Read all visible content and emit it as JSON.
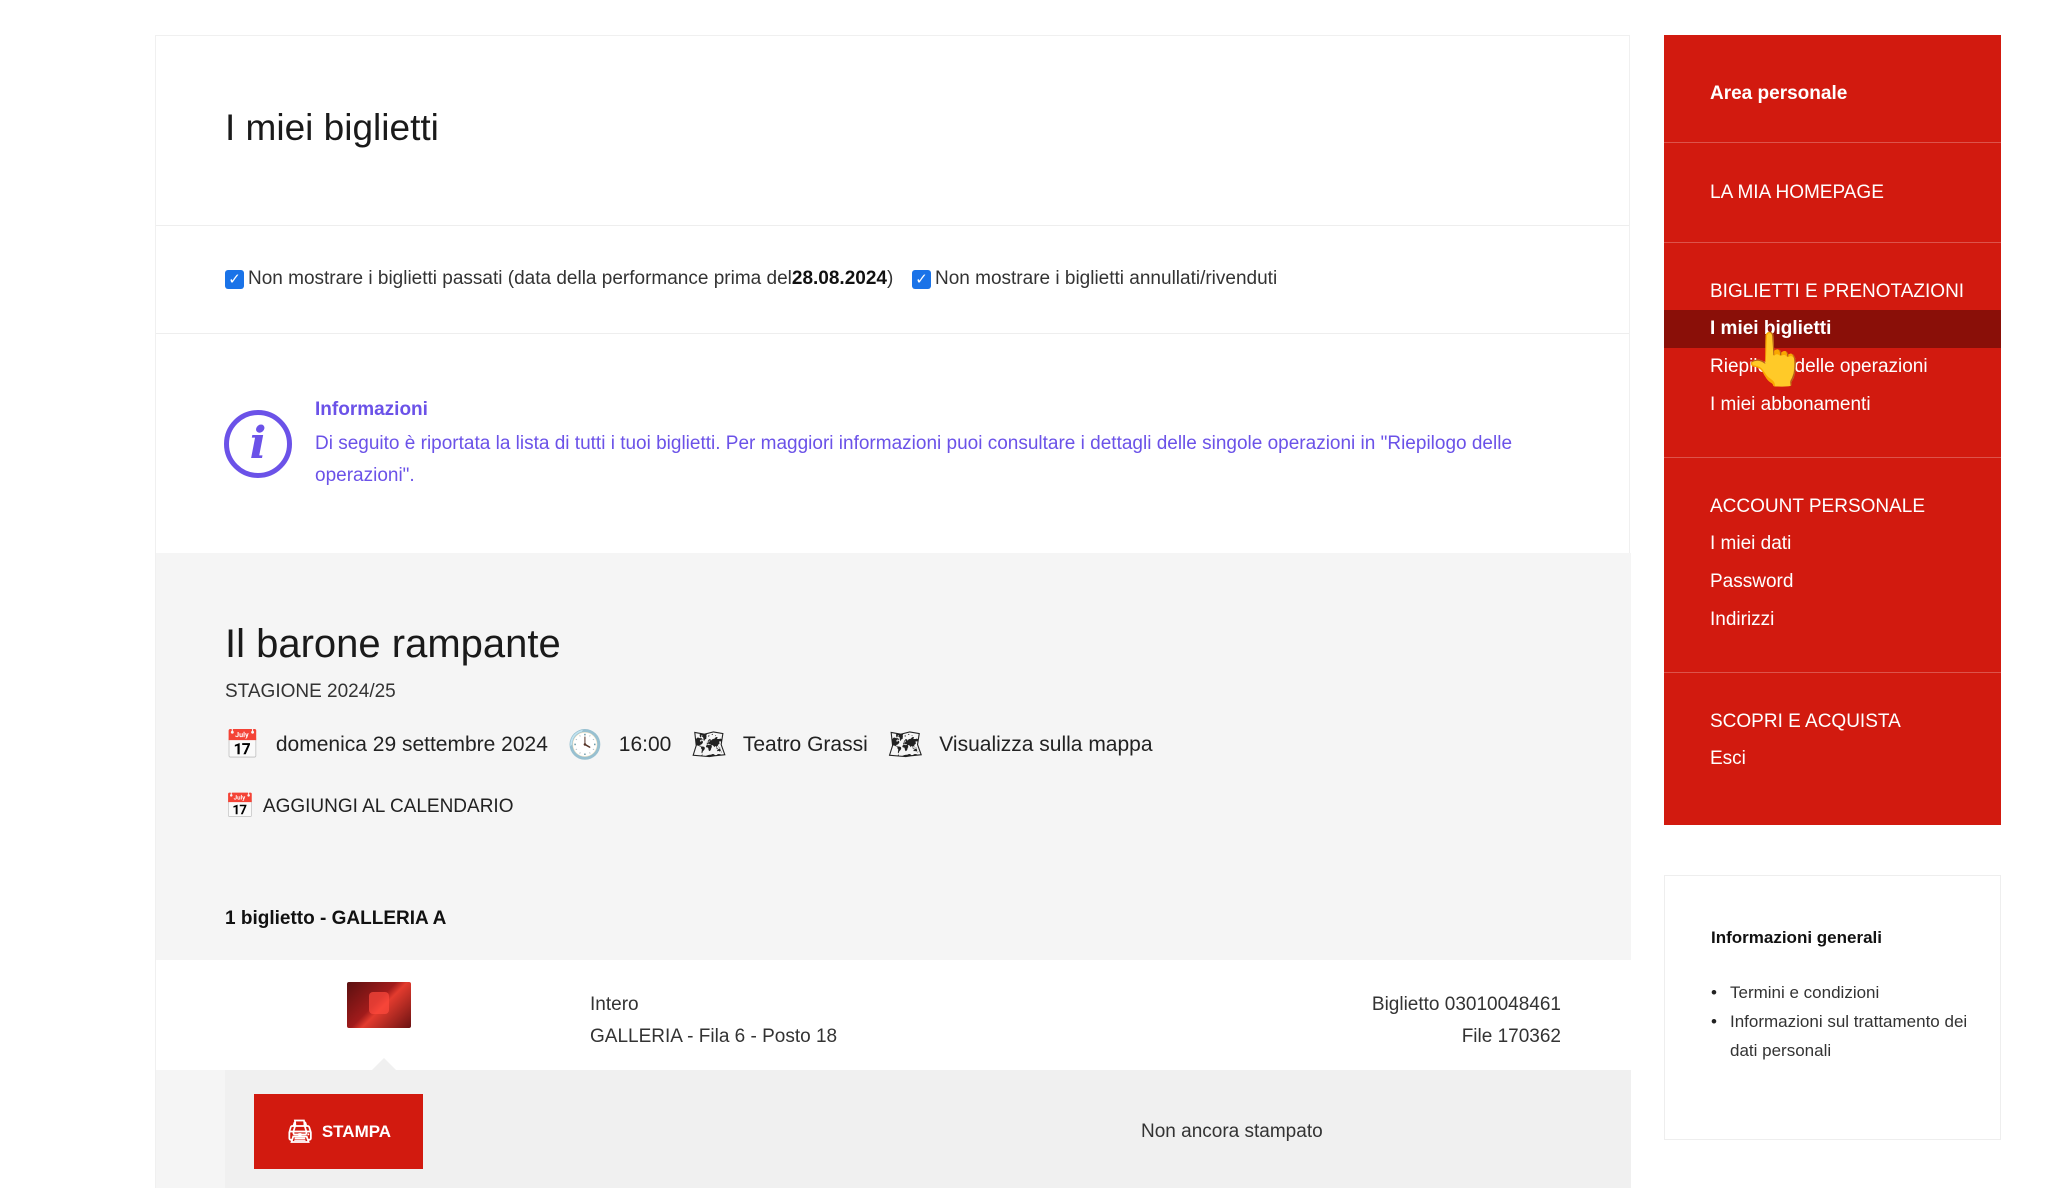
{
  "page": {
    "title": "I miei biglietti"
  },
  "filters": {
    "past_prefix": "Non mostrare i biglietti passati (data della performance prima del ",
    "past_date": "28.08.2024",
    "past_suffix": ")",
    "cancelled": "Non mostrare i biglietti annullati/rivenduti"
  },
  "info": {
    "title": "Informazioni",
    "text": "Di seguito è riportata la lista di tutti i tuoi biglietti. Per maggiori informazioni puoi consultare i dettagli delle singole operazioni in \"Riepilogo delle operazioni\"."
  },
  "event": {
    "title": "Il barone rampante",
    "season": "STAGIONE 2024/25",
    "date": "domenica 29 settembre 2024",
    "time": "16:00",
    "venue": "Teatro Grassi",
    "map_link": "Visualizza sulla mappa",
    "add_calendar": "AGGIUNGI AL CALENDARIO",
    "count_line": "1 biglietto - GALLERIA A"
  },
  "ticket": {
    "type": "Intero",
    "seat": "GALLERIA - Fila 6 - Posto 18",
    "number": "Biglietto 03010048461",
    "file": "File 170362",
    "print_label": "STAMPA",
    "print_status": "Non ancora stampato"
  },
  "sidebar": {
    "area": "Area personale",
    "homepage": "LA MIA HOMEPAGE",
    "tickets_heading": "BIGLIETTI E PRENOTAZIONI",
    "tickets_items": [
      "I miei biglietti",
      "Riepilogo delle operazioni",
      "I miei abbonamenti"
    ],
    "account_heading": "ACCOUNT PERSONALE",
    "account_items": [
      "I miei dati",
      "Password",
      "Indirizzi"
    ],
    "shop_heading": "SCOPRI E ACQUISTA",
    "logout": "Esci"
  },
  "general_info": {
    "title": "Informazioni generali",
    "links": [
      "Termini e condizioni",
      "Informazioni sul trattamento dei dati personali"
    ]
  },
  "icons": {
    "checkbox": "checkmark-icon",
    "info": "info-icon",
    "calendar": "calendar-icon",
    "clock": "clock-icon",
    "map": "map-icon",
    "printer": "printer-icon",
    "cursor": "hand-pointer-icon"
  },
  "colors": {
    "brand_red": "#d21a0f",
    "active_red": "#8a0f08",
    "info_purple": "#6b52e8",
    "checkbox_blue": "#1a73e8"
  }
}
